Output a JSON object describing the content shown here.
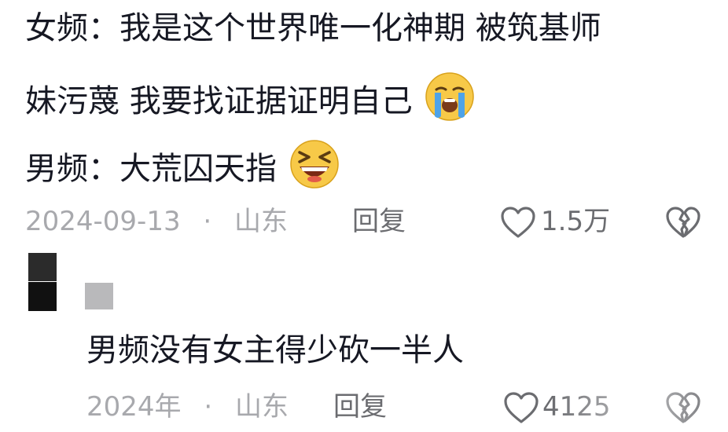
{
  "comment": {
    "line1": "女频：我是这个世界唯一化神期 被筑基师",
    "line2": "妹污蔑 我要找证据证明自己",
    "line3": "男频：大荒囚天指",
    "date": "2024-09-13",
    "dot": "·",
    "location": "山东",
    "reply_label": "回复",
    "like_count": "1.5万",
    "emoji1": "loudly-crying-face",
    "emoji2": "grinning-squinting-face"
  },
  "reply": {
    "text": "男频没有女主得少砍一半人",
    "date": "2024年",
    "dot": "·",
    "location": "山东",
    "reply_label": "回复",
    "like_count": "4125"
  },
  "colors": {
    "text": "#161823",
    "meta": "#a8a9ad",
    "secondary": "#6b6c70",
    "emoji_yellow": "#f7c948",
    "tear_blue": "#4ea3e8"
  }
}
